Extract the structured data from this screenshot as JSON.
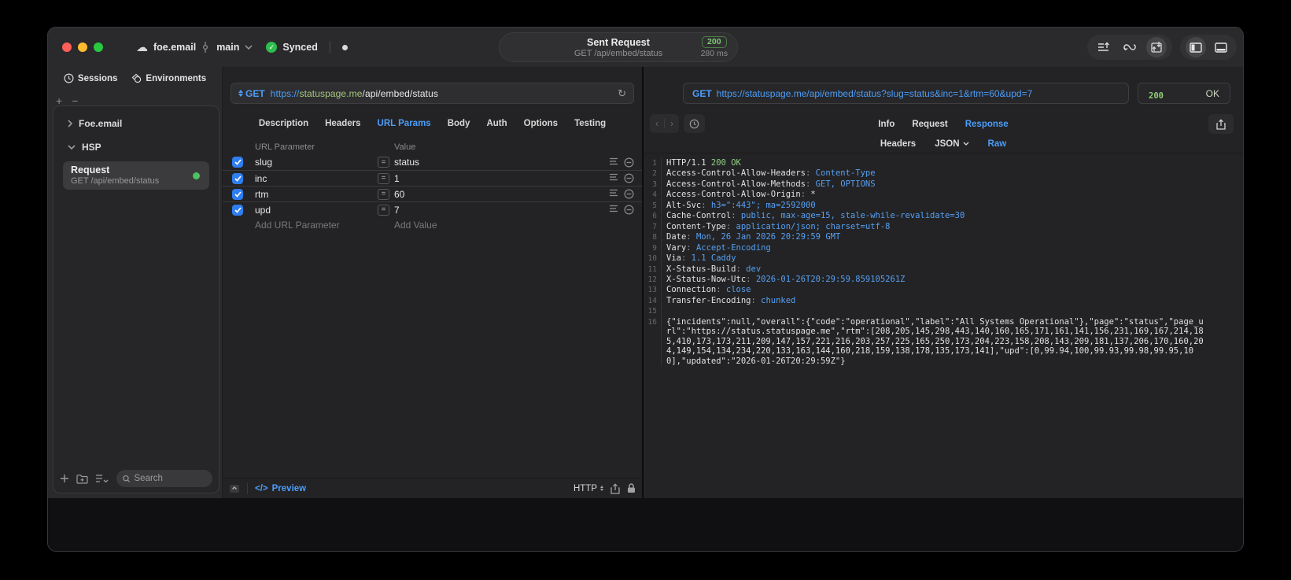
{
  "titlebar": {
    "project": "foe.email",
    "branch": "main",
    "sync_label": "Synced",
    "center": {
      "title": "Sent Request",
      "subtitle": "GET /api/embed/status",
      "status_code": "200",
      "duration": "280 ms"
    }
  },
  "sidebar": {
    "tabs": [
      {
        "label": "Sessions"
      },
      {
        "label": "Environments"
      }
    ],
    "plus": "+",
    "minus": "−",
    "tree": [
      {
        "label": "Foe.email"
      },
      {
        "label": "HSP"
      }
    ],
    "request_item": {
      "title": "Request",
      "subtitle": "GET /api/embed/status"
    },
    "search_placeholder": "Search"
  },
  "request_pane": {
    "method": "GET",
    "url": {
      "scheme": "https://",
      "host": "statuspage.me",
      "path": "/api/embed/status"
    },
    "tabs": [
      "Description",
      "Headers",
      "URL Params",
      "Body",
      "Auth",
      "Options",
      "Testing"
    ],
    "active_tab": "URL Params",
    "table": {
      "col_param": "URL Parameter",
      "col_value": "Value",
      "rows": [
        {
          "name": "slug",
          "value": "status",
          "enabled": true
        },
        {
          "name": "inc",
          "value": "1",
          "enabled": true
        },
        {
          "name": "rtm",
          "value": "60",
          "enabled": true
        },
        {
          "name": "upd",
          "value": "7",
          "enabled": true
        }
      ],
      "add_param": "Add URL Parameter",
      "add_value": "Add Value"
    },
    "footer": {
      "preview": "Preview",
      "code_glyph": "</>",
      "http": "HTTP"
    }
  },
  "response_pane": {
    "method": "GET",
    "url": "https://statuspage.me/api/embed/status?slug=status&inc=1&rtm=60&upd=7",
    "status_code": "200",
    "status_text": "OK",
    "tabs": [
      "Info",
      "Request",
      "Response"
    ],
    "active_tab": "Response",
    "subtabs": [
      "Headers",
      "JSON",
      "Raw"
    ],
    "active_subtab": "Raw",
    "code_lines": [
      {
        "n": "1",
        "seg": [
          {
            "t": "HTTP/1.1 ",
            "c": "k"
          },
          {
            "t": "200 OK",
            "c": "g"
          }
        ]
      },
      {
        "n": "2",
        "seg": [
          {
            "t": "Access-Control-Allow-Headers",
            "c": "k"
          },
          {
            "t": ": ",
            "c": "p"
          },
          {
            "t": "Content-Type",
            "c": "v"
          }
        ]
      },
      {
        "n": "3",
        "seg": [
          {
            "t": "Access-Control-Allow-Methods",
            "c": "k"
          },
          {
            "t": ": ",
            "c": "p"
          },
          {
            "t": "GET, OPTIONS",
            "c": "v"
          }
        ]
      },
      {
        "n": "4",
        "seg": [
          {
            "t": "Access-Control-Allow-Origin",
            "c": "k"
          },
          {
            "t": ": ",
            "c": "p"
          },
          {
            "t": "*",
            "c": "k"
          }
        ]
      },
      {
        "n": "5",
        "seg": [
          {
            "t": "Alt-Svc",
            "c": "k"
          },
          {
            "t": ": ",
            "c": "p"
          },
          {
            "t": "h3=\":443\"; ma=2592000",
            "c": "v"
          }
        ]
      },
      {
        "n": "6",
        "seg": [
          {
            "t": "Cache-Control",
            "c": "k"
          },
          {
            "t": ": ",
            "c": "p"
          },
          {
            "t": "public, max-age=15, stale-while-revalidate=30",
            "c": "v"
          }
        ]
      },
      {
        "n": "7",
        "seg": [
          {
            "t": "Content-Type",
            "c": "k"
          },
          {
            "t": ": ",
            "c": "p"
          },
          {
            "t": "application/json; charset=utf-8",
            "c": "v"
          }
        ]
      },
      {
        "n": "8",
        "seg": [
          {
            "t": "Date",
            "c": "k"
          },
          {
            "t": ": ",
            "c": "p"
          },
          {
            "t": "Mon, 26 Jan 2026 20:29:59 GMT",
            "c": "v"
          }
        ]
      },
      {
        "n": "9",
        "seg": [
          {
            "t": "Vary",
            "c": "k"
          },
          {
            "t": ": ",
            "c": "p"
          },
          {
            "t": "Accept-Encoding",
            "c": "v"
          }
        ]
      },
      {
        "n": "10",
        "seg": [
          {
            "t": "Via",
            "c": "k"
          },
          {
            "t": ": ",
            "c": "p"
          },
          {
            "t": "1.1 Caddy",
            "c": "v"
          }
        ]
      },
      {
        "n": "11",
        "seg": [
          {
            "t": "X-Status-Build",
            "c": "k"
          },
          {
            "t": ": ",
            "c": "p"
          },
          {
            "t": "dev",
            "c": "v"
          }
        ]
      },
      {
        "n": "12",
        "seg": [
          {
            "t": "X-Status-Now-Utc",
            "c": "k"
          },
          {
            "t": ": ",
            "c": "p"
          },
          {
            "t": "2026-01-26T20:29:59.859105261Z",
            "c": "v"
          }
        ]
      },
      {
        "n": "13",
        "seg": [
          {
            "t": "Connection",
            "c": "k"
          },
          {
            "t": ": ",
            "c": "p"
          },
          {
            "t": "close",
            "c": "v"
          }
        ]
      },
      {
        "n": "14",
        "seg": [
          {
            "t": "Transfer-Encoding",
            "c": "k"
          },
          {
            "t": ": ",
            "c": "p"
          },
          {
            "t": "chunked",
            "c": "v"
          }
        ]
      },
      {
        "n": "15",
        "seg": []
      },
      {
        "n": "16",
        "seg": [
          {
            "t": "{\"incidents\":null,\"overall\":{\"code\":\"operational\",\"label\":\"All Systems Operational\"},\"page\":\"status\",\"page_url\":\"https://status.statuspage.me\",\"rtm\":[208,205,145,298,443,140,160,165,171,161,141,156,231,169,167,214,185,410,173,173,211,209,147,157,221,216,203,257,225,165,250,173,204,223,158,208,143,209,181,137,206,170,160,204,149,154,134,234,220,133,163,144,160,218,159,138,178,135,173,141],\"upd\":[0,99.94,100,99.93,99.98,99.95,100],\"updated\":\"2026-01-26T20:29:59Z\"}",
            "c": "k"
          }
        ]
      }
    ]
  },
  "colors": {
    "accent_blue": "#4b9df8",
    "green_badge": "#7cc973",
    "url_host_green": "#a6c87e",
    "code_green": "#8fd080"
  }
}
